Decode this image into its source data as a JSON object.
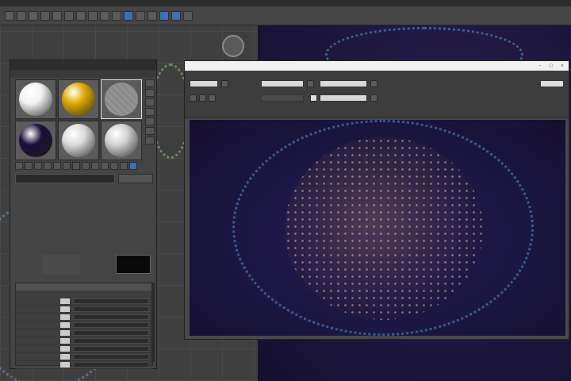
{
  "app": {
    "menu": [
      "",
      "",
      "",
      "",
      "",
      "",
      "",
      ""
    ],
    "accent": "#3f6fb6"
  },
  "material_editor": {
    "title": "",
    "menu": [
      "",
      "",
      "",
      "",
      ""
    ],
    "slots": [
      {
        "color": "#f2f2f2",
        "selected": false
      },
      {
        "color": "#e0a800",
        "selected": false
      },
      {
        "color": "#8e8e8e",
        "selected": true
      },
      {
        "color": "#1d0f3a",
        "selected": false
      },
      {
        "color": "#dcdcdc",
        "selected": false
      },
      {
        "color": "#d2d2d2",
        "selected": false
      }
    ],
    "material_name": "",
    "material_type": "",
    "rollout_title": "",
    "rollout_subtitle": "",
    "params": [
      {
        "label": "",
        "value": ""
      },
      {
        "label": "",
        "value": ""
      },
      {
        "label": "",
        "value": ""
      },
      {
        "label": "",
        "value": ""
      },
      {
        "label": "",
        "value": ""
      },
      {
        "label": "",
        "value": ""
      },
      {
        "label": "",
        "value": ""
      },
      {
        "label": "",
        "value": ""
      },
      {
        "label": "",
        "value": ""
      }
    ]
  },
  "render_window": {
    "title": "",
    "controls": [
      "–",
      "□",
      "×"
    ],
    "area_label": "",
    "viewport_label": "",
    "preset_label": "",
    "area_value": "",
    "viewport_value": "",
    "preset_value": ""
  }
}
